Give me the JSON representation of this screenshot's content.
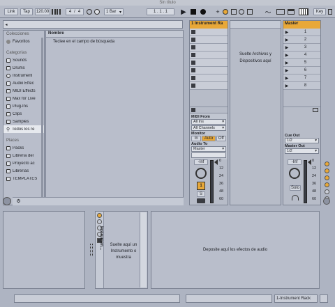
{
  "window": {
    "title": "Sin título"
  },
  "transport": {
    "link": "Link",
    "tap": "Tap",
    "tempo": "120.00",
    "sig_num": "4",
    "sig_den": "4",
    "bar": "1 Bar",
    "position": "1 .  1 .  1",
    "key": "Key"
  },
  "browser": {
    "collections_title": "Colecciones",
    "favorites": "Favoritos",
    "categories_title": "Categorías",
    "categories": [
      "Sounds",
      "Drums",
      "Instrument",
      "Audio Effec",
      "MIDI Effects",
      "Max for Live",
      "Plug-Ins",
      "Clips",
      "Samples",
      "Todos los re"
    ],
    "places_title": "Places",
    "places": [
      "Packs",
      "Librería del",
      "Proyecto ac",
      "Librerías",
      "TEMPLATES"
    ],
    "column_header": "Nombre",
    "search_hint": "Teclee en el campo de búsqueda"
  },
  "track": {
    "name": "1 Instrument Ra",
    "drop_text": "Suelte Archivos y Dispositivos aquí",
    "midi_from_label": "MIDI From",
    "midi_from": "All Ins",
    "channel": "All Channels",
    "monitor_label": "Monitor",
    "monitor_in": "In",
    "monitor_auto": "Auto",
    "monitor_off": "Off",
    "audio_to_label": "Audio To",
    "audio_to": "Master",
    "volume": "-Inf",
    "track_number": "1",
    "solo": "S"
  },
  "master": {
    "name": "Master",
    "scenes": [
      "1",
      "2",
      "3",
      "4",
      "5",
      "6",
      "7",
      "8"
    ],
    "cue_out_label": "Cue Out",
    "cue_out": "1/2",
    "master_out_label": "Master Out",
    "master_out": "1/2",
    "volume": "-Inf",
    "solo": "Solo"
  },
  "meter_ticks": [
    "0",
    "12",
    "24",
    "36",
    "48",
    "60"
  ],
  "device": {
    "rack_name": "Instrumen...",
    "instrument_drop": "Suelte aquí un Instrumento o muestra",
    "effects_drop": "Deposite aquí los efectos de audio"
  },
  "status": {
    "track_label": "1-Instrument Rack"
  }
}
